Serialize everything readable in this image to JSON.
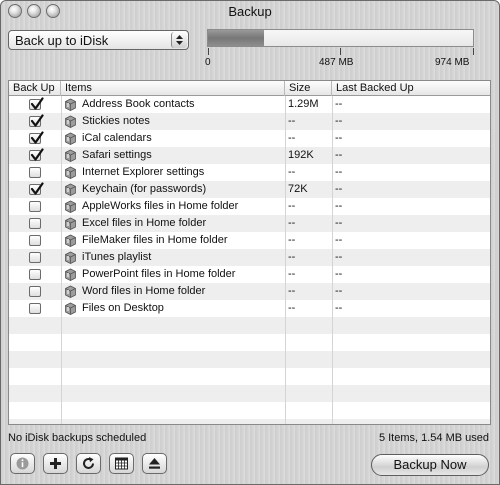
{
  "window": {
    "title": "Backup"
  },
  "destination": {
    "selected": "Back up to iDisk"
  },
  "capacity": {
    "used_fraction": 0.21,
    "scale_labels": [
      "0",
      "487 MB",
      "974 MB"
    ]
  },
  "table": {
    "columns": [
      "Back Up",
      "Items",
      "Size",
      "Last Backed Up"
    ],
    "rows": [
      {
        "checked": true,
        "name": "Address Book contacts",
        "size": "1.29M",
        "last": "--"
      },
      {
        "checked": true,
        "name": "Stickies notes",
        "size": "--",
        "last": "--"
      },
      {
        "checked": true,
        "name": "iCal calendars",
        "size": "--",
        "last": "--"
      },
      {
        "checked": true,
        "name": "Safari settings",
        "size": "192K",
        "last": "--"
      },
      {
        "checked": false,
        "name": "Internet Explorer settings",
        "size": "--",
        "last": "--"
      },
      {
        "checked": true,
        "name": "Keychain (for passwords)",
        "size": "72K",
        "last": "--"
      },
      {
        "checked": false,
        "name": "AppleWorks files in Home folder",
        "size": "--",
        "last": "--"
      },
      {
        "checked": false,
        "name": "Excel files in Home folder",
        "size": "--",
        "last": "--"
      },
      {
        "checked": false,
        "name": "FileMaker files in Home folder",
        "size": "--",
        "last": "--"
      },
      {
        "checked": false,
        "name": "iTunes playlist",
        "size": "--",
        "last": "--"
      },
      {
        "checked": false,
        "name": "PowerPoint files in Home folder",
        "size": "--",
        "last": "--"
      },
      {
        "checked": false,
        "name": "Word files in Home folder",
        "size": "--",
        "last": "--"
      },
      {
        "checked": false,
        "name": "Files on Desktop",
        "size": "--",
        "last": "--"
      }
    ]
  },
  "status": {
    "schedule": "No iDisk backups scheduled",
    "summary": "5 Items, 1.54 MB used"
  },
  "toolbar": {
    "icons": [
      "info-icon",
      "add-icon",
      "refresh-icon",
      "calendar-icon",
      "eject-icon"
    ],
    "backup_now_label": "Backup Now"
  }
}
